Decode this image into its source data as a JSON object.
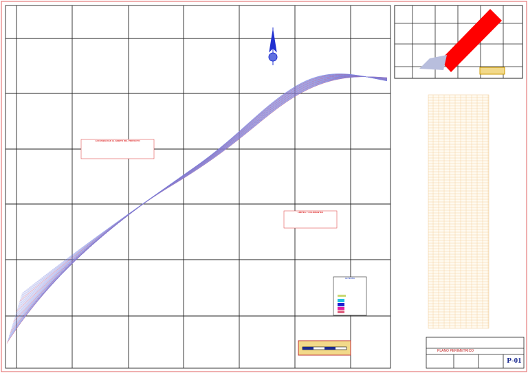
{
  "title_block": {
    "plan_title": "PLANO PERIMETRICO",
    "sheet_number": "P-01"
  },
  "tables": {
    "access_title": "ACCESIBILIDAD AL AMBITO DEL PROYECTO",
    "limits_title": "LIMITES Y COLINDANTES",
    "legend_title": "LEYENDA"
  },
  "colors": {
    "frame": "#d33",
    "grid": "#222",
    "contour": "#5560d8",
    "road": "#d04060",
    "highlight": "#ff0000"
  }
}
